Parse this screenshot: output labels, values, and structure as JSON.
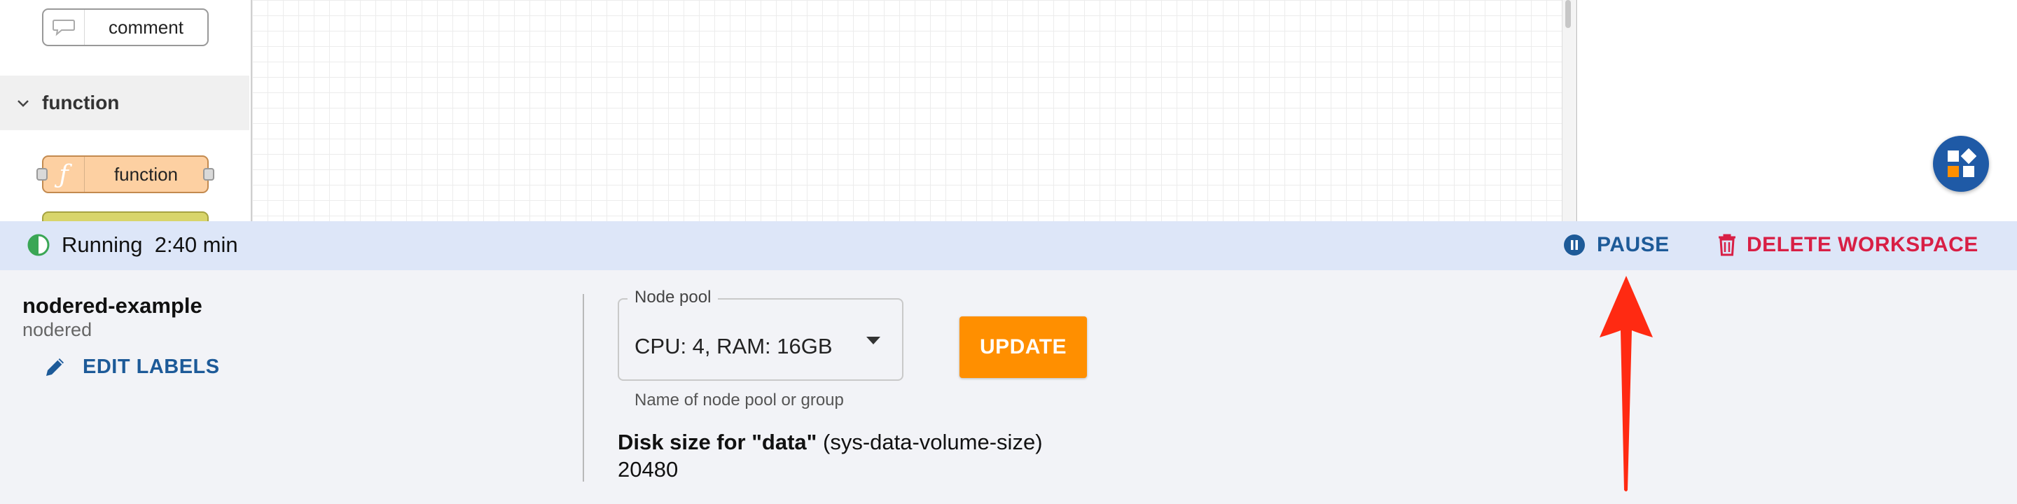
{
  "palette": {
    "comment_node_label": "comment",
    "category_label": "function",
    "function_node_label": "function"
  },
  "status": {
    "state": "Running",
    "elapsed": "2:40 min",
    "pause_label": "PAUSE",
    "delete_label": "DELETE WORKSPACE"
  },
  "workspace": {
    "name": "nodered-example",
    "type": "nodered",
    "edit_labels_label": "EDIT LABELS"
  },
  "node_pool": {
    "legend": "Node pool",
    "value": "CPU: 4, RAM: 16GB",
    "helper": "Name of node pool or group",
    "update_label": "UPDATE"
  },
  "disk": {
    "label_bold": "Disk size for \"data\"",
    "label_key": "(sys-data-volume-size)",
    "value": "20480"
  },
  "colors": {
    "status_bar": "#dde6f8",
    "primary_blue": "#1d5a98",
    "danger_red": "#d81f45",
    "update_orange": "#ff8f00",
    "running_green": "#3aa655",
    "annotation_arrow": "#ff2a12"
  }
}
